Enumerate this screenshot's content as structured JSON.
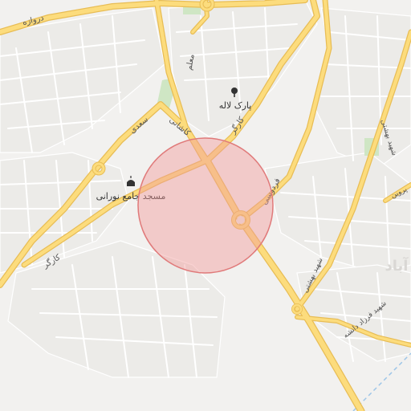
{
  "map": {
    "colors": {
      "background": "#f2f1ef",
      "block_fill": "#ecebe8",
      "minor_road": "#ffffff",
      "major_road_fill": "#fcdc7d",
      "major_road_casing": "#e8bd55",
      "park": "#cfe6c4",
      "radius_fill": "#f29b9b",
      "radius_stroke": "#e07a7a",
      "water_line": "#9fc6e8"
    },
    "street_labels": {
      "darvazeh": "دروازه",
      "moallem": "معلم",
      "saadi": "سعدی",
      "kashani": "کاشانی",
      "kargar_north": "کارگر",
      "kargar_west": "کارگر",
      "ferdowsi": "فردوسی",
      "beheshti_east": "شهید بهشتی",
      "beheshti_south": "شهید بهشتی",
      "parvin": "پروین",
      "farzad": "شهید فرزاد دانشه"
    },
    "pois": {
      "park_laleh": {
        "name": "پارک لاله",
        "icon": "tree-icon"
      },
      "mosque": {
        "name": "مسجد جامع نورانی",
        "icon": "mosque-icon"
      }
    },
    "area_label": "آباد",
    "search_area": {
      "shape": "circle",
      "style": "semi-transparent red"
    }
  }
}
